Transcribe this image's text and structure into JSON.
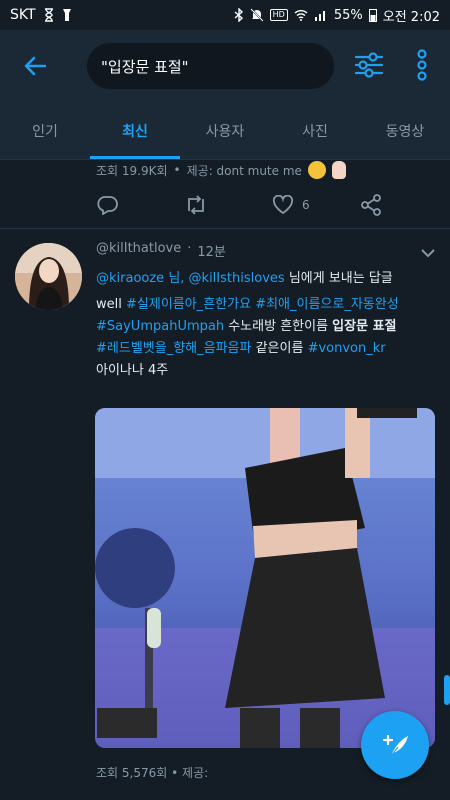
{
  "status_bar": {
    "carrier": "SKT",
    "battery": "55%",
    "time": "오전 2:02",
    "hd_label": "HD"
  },
  "header": {
    "search_query": "\"입장문 표절\""
  },
  "tabs": [
    {
      "label": "인기",
      "active": false
    },
    {
      "label": "최신",
      "active": true
    },
    {
      "label": "사용자",
      "active": false
    },
    {
      "label": "사진",
      "active": false
    },
    {
      "label": "동영상",
      "active": false
    }
  ],
  "tweet1": {
    "views": "조회 19.9K회",
    "provided": "제공: dont mute me",
    "like_count": "6"
  },
  "tweet2": {
    "handle": "@kilIthatlove",
    "time": "12분",
    "reply_to_1": "@kiraooze 님,",
    "reply_to_2": "@kilIsthisloves",
    "reply_suffix": "님에게 보내는 답글",
    "line1_word": "well",
    "tag1": "#실제이름아_흔한가요",
    "tag2": "#최애_이름으로_자동완성",
    "tag3": "#SayUmpahUmpah",
    "line3_text": "수노래방 흔한이름",
    "line3_bold": "입장문 표절",
    "tag4": "#레드벨벳을_향해_음파음파",
    "line4_text": "같은이름",
    "tag5": "#vonvon_kr",
    "line5": "아이나나 4주",
    "views": "조회 5,576회",
    "provided": "제공:"
  },
  "colors": {
    "accent": "#1da1f2",
    "background": "#141d26",
    "surface": "#1b2836",
    "muted": "#8899a6"
  }
}
